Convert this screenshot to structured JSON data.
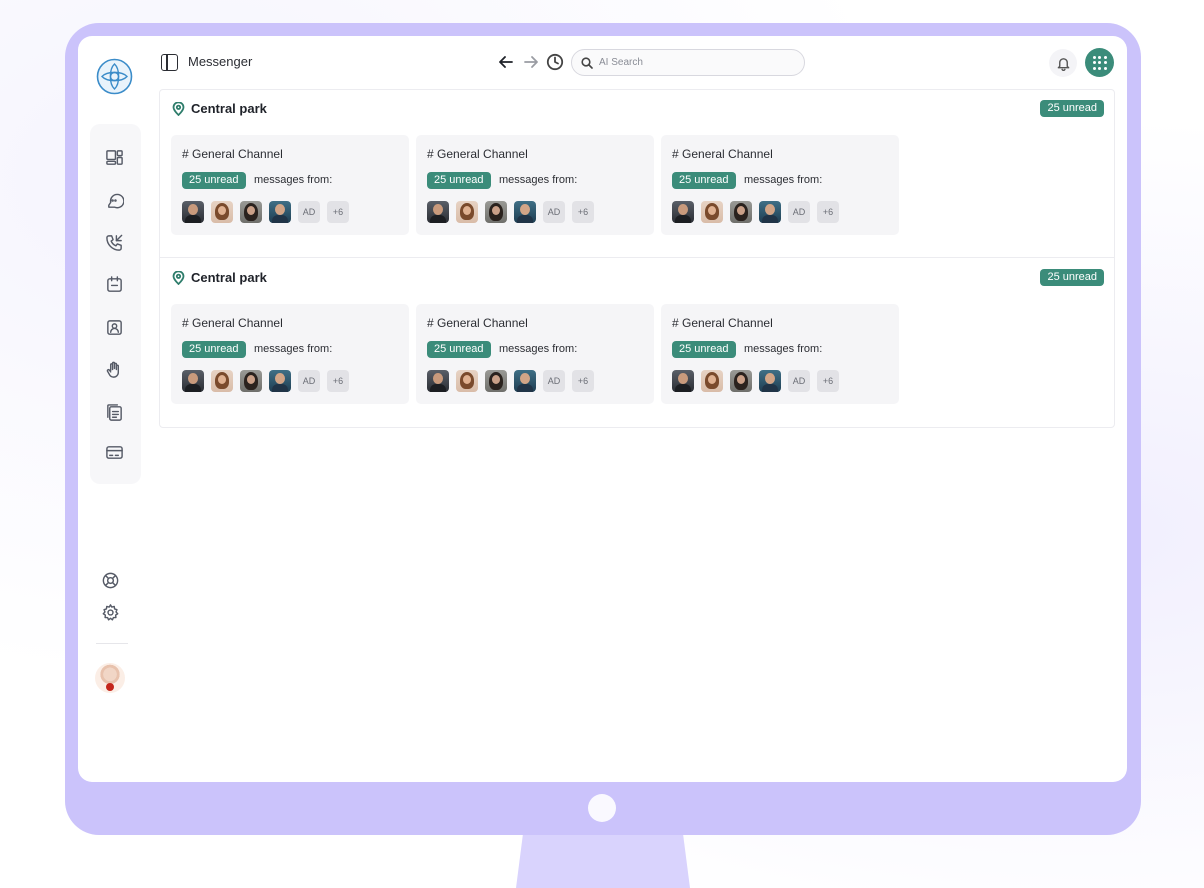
{
  "header": {
    "app_title": "Messenger",
    "search_placeholder": "AI Search"
  },
  "sidebar": {
    "items": [
      {
        "icon": "dashboard-icon"
      },
      {
        "icon": "chat-icon"
      },
      {
        "icon": "phone-icon"
      },
      {
        "icon": "calendar-icon"
      },
      {
        "icon": "contact-card-icon"
      },
      {
        "icon": "hand-icon"
      },
      {
        "icon": "documents-icon"
      },
      {
        "icon": "billing-card-icon"
      }
    ],
    "footer_items": [
      {
        "icon": "support-icon"
      },
      {
        "icon": "settings-icon"
      }
    ]
  },
  "colors": {
    "accent": "#3b8c7a",
    "monitor_frame": "#cbc3fb"
  },
  "sections": [
    {
      "location": "Central park",
      "unread": "25 unread",
      "channels": [
        {
          "name": "# General Channel",
          "unread": "25 unread",
          "from_label": "messages from:",
          "initials": "AD",
          "more": "+6"
        },
        {
          "name": "# General Channel",
          "unread": "25 unread",
          "from_label": "messages from:",
          "initials": "AD",
          "more": "+6"
        },
        {
          "name": "# General Channel",
          "unread": "25 unread",
          "from_label": "messages from:",
          "initials": "AD",
          "more": "+6"
        }
      ]
    },
    {
      "location": "Central park",
      "unread": "25 unread",
      "channels": [
        {
          "name": "# General Channel",
          "unread": "25 unread",
          "from_label": "messages from:",
          "initials": "AD",
          "more": "+6"
        },
        {
          "name": "# General Channel",
          "unread": "25 unread",
          "from_label": "messages from:",
          "initials": "AD",
          "more": "+6"
        },
        {
          "name": "# General Channel",
          "unread": "25 unread",
          "from_label": "messages from:",
          "initials": "AD",
          "more": "+6"
        }
      ]
    }
  ]
}
